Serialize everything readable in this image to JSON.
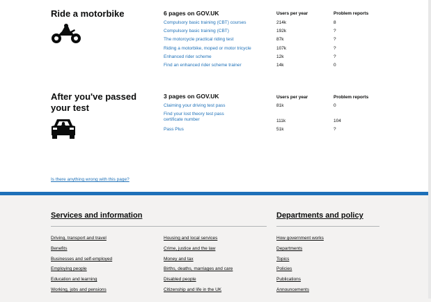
{
  "sections": [
    {
      "title_lines": [
        "Ride a motorbike"
      ],
      "icon": "motorbike-icon",
      "pages_heading": "6 pages on GOV.UK",
      "col_users": "Users per year",
      "col_reports": "Problem reports",
      "rows": [
        {
          "label": "Compulsory basic training (CBT) courses",
          "users": "214k",
          "reports": "8"
        },
        {
          "label": "Compulsory basic training (CBT)",
          "users": "192k",
          "reports": "?"
        },
        {
          "label": "The motorcycle practical riding test",
          "users": "87k",
          "reports": "?"
        },
        {
          "label": "Riding a motorbike, moped or motor tricycle",
          "users": "107k",
          "reports": "?"
        },
        {
          "label": "Enhanced rider scheme",
          "users": "12k",
          "reports": "?"
        },
        {
          "label": "Find an enhanced rider scheme trainer",
          "users": "14k",
          "reports": "0"
        }
      ]
    },
    {
      "title_lines": [
        "After you've passed",
        "your test"
      ],
      "icon": "car-icon",
      "pages_heading": "3 pages on GOV.UK",
      "col_users": "Users per year",
      "col_reports": "Problem reports",
      "rows": [
        {
          "label": "Claiming your driving test pass",
          "users": "81k",
          "reports": "0"
        },
        {
          "label": "Find your lost theory test pass certificate number",
          "users": "111k",
          "reports": "104"
        },
        {
          "label": "Pass Plus",
          "users": "51k",
          "reports": "?"
        }
      ]
    }
  ],
  "feedback_link": "Is there anything wrong with this page?",
  "footer": {
    "services_heading": "Services and information",
    "departments_heading": "Departments and policy",
    "services_col1": [
      "Driving, transport and travel",
      "Benefits",
      "Businesses and self-employed",
      "Employing people",
      "Education and learning",
      "Working, jobs and pensions"
    ],
    "services_col2": [
      "Housing and local services",
      "Crime, justice and the law",
      "Money and tax",
      "Births, deaths, marriages and care",
      "Disabled people",
      "Citizenship and life in the UK"
    ],
    "departments": [
      "How government works",
      "Departments",
      "Topics",
      "Policies",
      "Publications",
      "Announcements"
    ]
  },
  "colors": {
    "link": "#1d70b8",
    "text": "#0b0c0c",
    "footer_bg": "#f3f2f1",
    "footer_border": "#1d70b8"
  }
}
